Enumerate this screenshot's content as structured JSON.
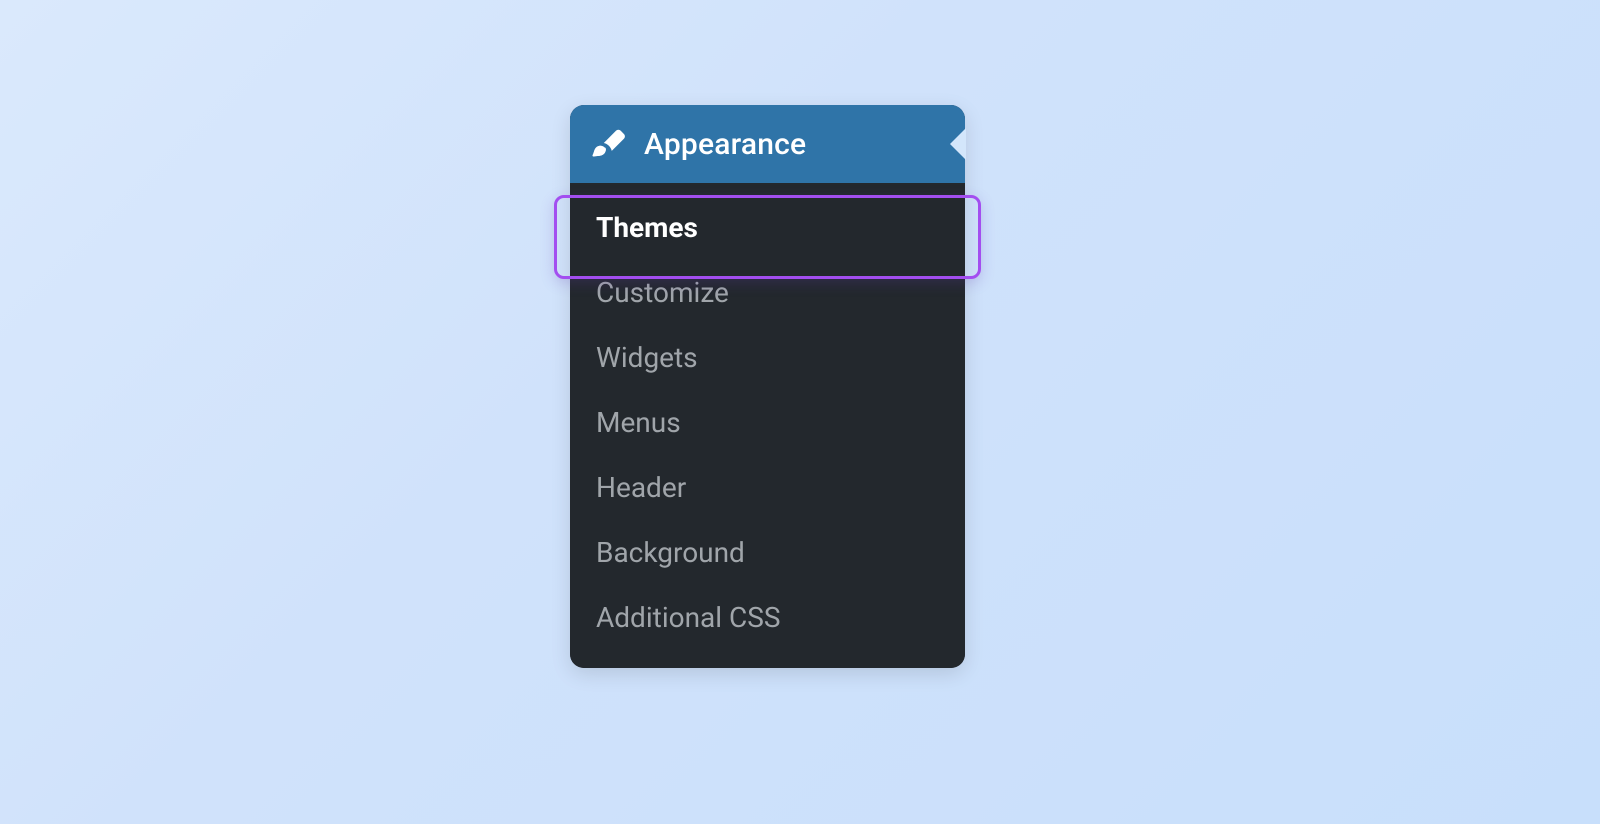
{
  "menu": {
    "title": "Appearance",
    "items": [
      {
        "label": "Themes",
        "active": true
      },
      {
        "label": "Customize",
        "active": false
      },
      {
        "label": "Widgets",
        "active": false
      },
      {
        "label": "Menus",
        "active": false
      },
      {
        "label": "Header",
        "active": false
      },
      {
        "label": "Background",
        "active": false
      },
      {
        "label": "Additional CSS",
        "active": false
      }
    ]
  }
}
